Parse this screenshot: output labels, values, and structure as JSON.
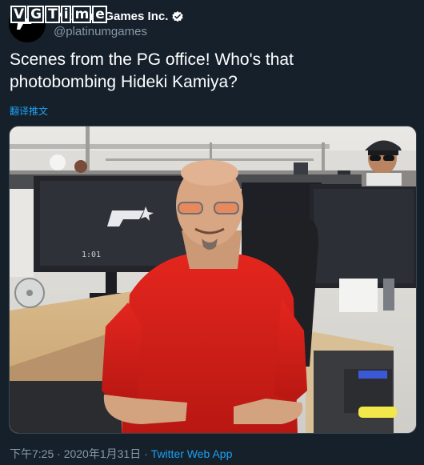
{
  "author": {
    "display_name": "PlatinumGames Inc.",
    "handle": "@platinumgames",
    "verified": true,
    "avatar_icon": "platinumgames-logo-icon"
  },
  "watermark": {
    "letters": [
      "V",
      "G",
      "T",
      "i",
      "m",
      "e"
    ]
  },
  "tweet": {
    "text_line1": "Scenes from the PG office! Who's that",
    "text_line2": "photobombing Hideki Kamiya?",
    "translate_label": "翻译推文"
  },
  "photo": {
    "description_icon": "office-photo-image",
    "monitor_logo": "P",
    "monitor_time": "1:01"
  },
  "meta": {
    "time": "下午7:25",
    "separator": " · ",
    "date": "2020年1月31日",
    "separator2": " · ",
    "source": "Twitter Web App"
  },
  "colors": {
    "background": "#15202b",
    "primary_text": "#ffffff",
    "secondary_text": "#8899a6",
    "accent": "#1da1f2"
  }
}
